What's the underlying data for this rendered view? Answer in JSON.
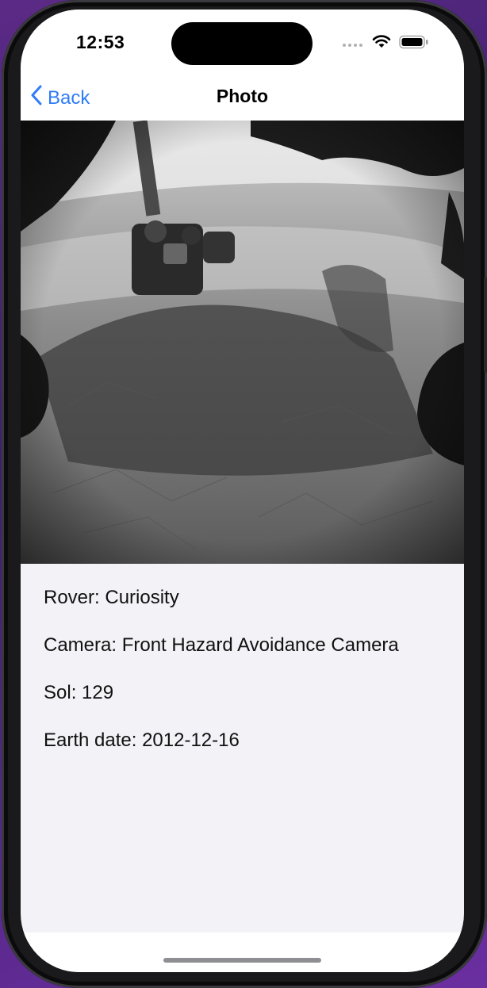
{
  "status_bar": {
    "time": "12:53",
    "icons": [
      "cellular-signal-icon",
      "wifi-icon",
      "battery-icon"
    ]
  },
  "nav": {
    "back_label": "Back",
    "title": "Photo"
  },
  "photo": {
    "icon": "mars-rover-photo"
  },
  "details": {
    "rover": "Rover: Curiosity",
    "camera": "Camera: Front Hazard Avoidance Camera",
    "sol": "Sol: 129",
    "earth_date": "Earth date: 2012-12-16"
  },
  "colors": {
    "accent": "#2f7cf6",
    "background": "#f2f2f7"
  }
}
